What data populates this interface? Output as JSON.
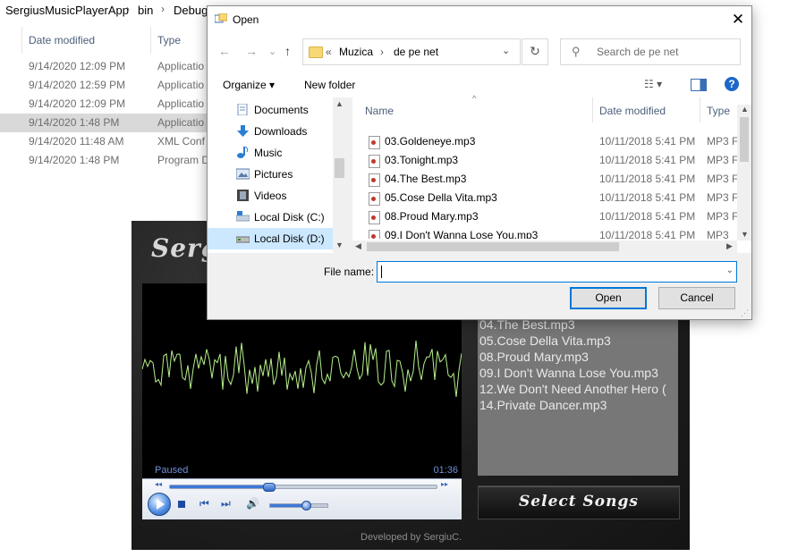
{
  "explorer": {
    "breadcrumb": [
      "SergiusMusicPlayerApp",
      "bin",
      "Debug"
    ],
    "columns": {
      "date": "Date modified",
      "type": "Type"
    },
    "rows": [
      {
        "date": "9/14/2020 12:09 PM",
        "type": "Applicatio"
      },
      {
        "date": "9/14/2020 12:59 PM",
        "type": "Applicatio"
      },
      {
        "date": "9/14/2020 12:09 PM",
        "type": "Applicatio"
      },
      {
        "date": "9/14/2020 1:48 PM",
        "type": "Applicatio"
      },
      {
        "date": "9/14/2020 11:48 AM",
        "type": "XML Conf"
      },
      {
        "date": "9/14/2020 1:48 PM",
        "type": "Program D"
      }
    ]
  },
  "player": {
    "title": "Sergi",
    "status": "Paused",
    "time": "01:36",
    "seek_fraction": 0.37,
    "volume_fraction": 0.62,
    "playlist": [
      "04.The Best.mp3",
      "05.Cose Della Vita.mp3",
      "08.Proud Mary.mp3",
      "09.I Don't Wanna Lose You.mp3",
      "12.We Don't Need Another Hero (",
      "14.Private Dancer.mp3"
    ],
    "select_label": "Select Songs",
    "footer": "Developed by SergiuC."
  },
  "dialog": {
    "title": "Open",
    "close_glyph": "✕",
    "nav": {
      "back": "←",
      "forward": "→",
      "recent": "⌄",
      "up": "↑"
    },
    "address": {
      "chevron": "«",
      "parts": [
        "Muzica",
        "›",
        "de pe net"
      ],
      "dropdown": "⌄"
    },
    "refresh": "↻",
    "search_placeholder": "Search de pe net",
    "search_icon": "⚲",
    "toolbar": {
      "organize": "Organize ▾",
      "new_folder": "New folder",
      "help": "?",
      "view": "☷ ▾"
    },
    "nav_items": [
      {
        "label": "Documents",
        "icon": "documents-icon",
        "color": "#6d8fbd"
      },
      {
        "label": "Downloads",
        "icon": "downloads-icon",
        "color": "#2a7fd4"
      },
      {
        "label": "Music",
        "icon": "music-icon",
        "color": "#2a7fd4"
      },
      {
        "label": "Pictures",
        "icon": "pictures-icon",
        "color": "#5a7ba8"
      },
      {
        "label": "Videos",
        "icon": "videos-icon",
        "color": "#444444"
      },
      {
        "label": "Local Disk (C:)",
        "icon": "drive-c-icon",
        "color": "#8aa0b8"
      },
      {
        "label": "Local Disk (D:)",
        "icon": "drive-d-icon",
        "color": "#8a8a8a"
      }
    ],
    "selected_nav": 6,
    "columns": {
      "name": "Name",
      "date": "Date modified",
      "type": "Type"
    },
    "files": [
      {
        "name": "03.Goldeneye.mp3",
        "date": "10/11/2018 5:41 PM",
        "type": "MP3 F"
      },
      {
        "name": "03.Tonight.mp3",
        "date": "10/11/2018 5:41 PM",
        "type": "MP3 F"
      },
      {
        "name": "04.The Best.mp3",
        "date": "10/11/2018 5:41 PM",
        "type": "MP3 F"
      },
      {
        "name": "05.Cose Della Vita.mp3",
        "date": "10/11/2018 5:41 PM",
        "type": "MP3 F"
      },
      {
        "name": "08.Proud Mary.mp3",
        "date": "10/11/2018 5:41 PM",
        "type": "MP3 F"
      },
      {
        "name": "09.I Don't Wanna Lose You.mp3",
        "date": "10/11/2018 5:41 PM",
        "type": "MP3 F"
      }
    ],
    "filename_label": "File name:",
    "filename_value": "",
    "open_label": "Open",
    "cancel_label": "Cancel"
  },
  "colors": {
    "accent": "#0078d7",
    "wave": "#b5f08a",
    "status_text": "#6e8fd8"
  }
}
